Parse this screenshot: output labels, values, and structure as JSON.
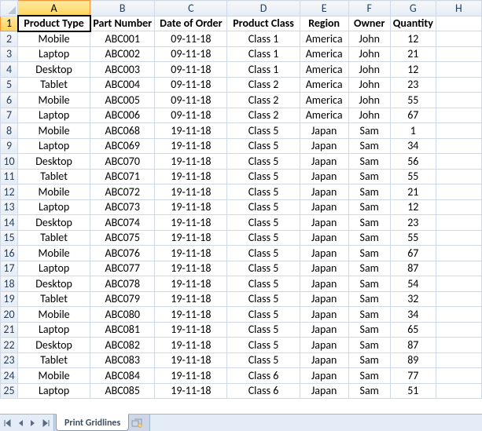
{
  "columns": [
    "A",
    "B",
    "C",
    "D",
    "E",
    "F",
    "G",
    "H"
  ],
  "row_numbers": [
    1,
    2,
    3,
    4,
    5,
    6,
    7,
    8,
    9,
    10,
    11,
    12,
    13,
    14,
    15,
    16,
    17,
    18,
    19,
    20,
    21,
    22,
    23,
    24,
    25
  ],
  "active_cell": "A1",
  "header": {
    "A": "Product Type",
    "B": "Part Number",
    "C": "Date of Order",
    "D": "Product Class",
    "E": "Region",
    "F": "Owner",
    "G": "Quantity"
  },
  "rows": [
    {
      "A": "Mobile",
      "B": "ABC001",
      "C": "09-11-18",
      "D": "Class 1",
      "E": "America",
      "F": "John",
      "G": "12"
    },
    {
      "A": "Laptop",
      "B": "ABC002",
      "C": "09-11-18",
      "D": "Class 1",
      "E": "America",
      "F": "John",
      "G": "21"
    },
    {
      "A": "Desktop",
      "B": "ABC003",
      "C": "09-11-18",
      "D": "Class 1",
      "E": "America",
      "F": "John",
      "G": "12"
    },
    {
      "A": "Tablet",
      "B": "ABC004",
      "C": "09-11-18",
      "D": "Class 2",
      "E": "America",
      "F": "John",
      "G": "23"
    },
    {
      "A": "Mobile",
      "B": "ABC005",
      "C": "09-11-18",
      "D": "Class 2",
      "E": "America",
      "F": "John",
      "G": "55"
    },
    {
      "A": "Laptop",
      "B": "ABC006",
      "C": "09-11-18",
      "D": "Class 2",
      "E": "America",
      "F": "John",
      "G": "67"
    },
    {
      "A": "Mobile",
      "B": "ABC068",
      "C": "19-11-18",
      "D": "Class 5",
      "E": "Japan",
      "F": "Sam",
      "G": "1"
    },
    {
      "A": "Laptop",
      "B": "ABC069",
      "C": "19-11-18",
      "D": "Class 5",
      "E": "Japan",
      "F": "Sam",
      "G": "34"
    },
    {
      "A": "Desktop",
      "B": "ABC070",
      "C": "19-11-18",
      "D": "Class 5",
      "E": "Japan",
      "F": "Sam",
      "G": "56"
    },
    {
      "A": "Tablet",
      "B": "ABC071",
      "C": "19-11-18",
      "D": "Class 5",
      "E": "Japan",
      "F": "Sam",
      "G": "55"
    },
    {
      "A": "Mobile",
      "B": "ABC072",
      "C": "19-11-18",
      "D": "Class 5",
      "E": "Japan",
      "F": "Sam",
      "G": "21"
    },
    {
      "A": "Laptop",
      "B": "ABC073",
      "C": "19-11-18",
      "D": "Class 5",
      "E": "Japan",
      "F": "Sam",
      "G": "12"
    },
    {
      "A": "Desktop",
      "B": "ABC074",
      "C": "19-11-18",
      "D": "Class 5",
      "E": "Japan",
      "F": "Sam",
      "G": "23"
    },
    {
      "A": "Tablet",
      "B": "ABC075",
      "C": "19-11-18",
      "D": "Class 5",
      "E": "Japan",
      "F": "Sam",
      "G": "55"
    },
    {
      "A": "Mobile",
      "B": "ABC076",
      "C": "19-11-18",
      "D": "Class 5",
      "E": "Japan",
      "F": "Sam",
      "G": "67"
    },
    {
      "A": "Laptop",
      "B": "ABC077",
      "C": "19-11-18",
      "D": "Class 5",
      "E": "Japan",
      "F": "Sam",
      "G": "87"
    },
    {
      "A": "Desktop",
      "B": "ABC078",
      "C": "19-11-18",
      "D": "Class 5",
      "E": "Japan",
      "F": "Sam",
      "G": "54"
    },
    {
      "A": "Tablet",
      "B": "ABC079",
      "C": "19-11-18",
      "D": "Class 5",
      "E": "Japan",
      "F": "Sam",
      "G": "32"
    },
    {
      "A": "Mobile",
      "B": "ABC080",
      "C": "19-11-18",
      "D": "Class 5",
      "E": "Japan",
      "F": "Sam",
      "G": "34"
    },
    {
      "A": "Laptop",
      "B": "ABC081",
      "C": "19-11-18",
      "D": "Class 5",
      "E": "Japan",
      "F": "Sam",
      "G": "65"
    },
    {
      "A": "Desktop",
      "B": "ABC082",
      "C": "19-11-18",
      "D": "Class 5",
      "E": "Japan",
      "F": "Sam",
      "G": "87"
    },
    {
      "A": "Tablet",
      "B": "ABC083",
      "C": "19-11-18",
      "D": "Class 5",
      "E": "Japan",
      "F": "Sam",
      "G": "89"
    },
    {
      "A": "Mobile",
      "B": "ABC084",
      "C": "19-11-18",
      "D": "Class 6",
      "E": "Japan",
      "F": "Sam",
      "G": "77"
    },
    {
      "A": "Laptop",
      "B": "ABC085",
      "C": "19-11-18",
      "D": "Class 6",
      "E": "Japan",
      "F": "Sam",
      "G": "51"
    }
  ],
  "sheet_tabs": {
    "nav": {
      "first": "|◂",
      "prev": "◂",
      "next": "▸",
      "last": "▸|"
    },
    "active_tab": "Print Gridlines",
    "new_tab_icon": "✧"
  }
}
